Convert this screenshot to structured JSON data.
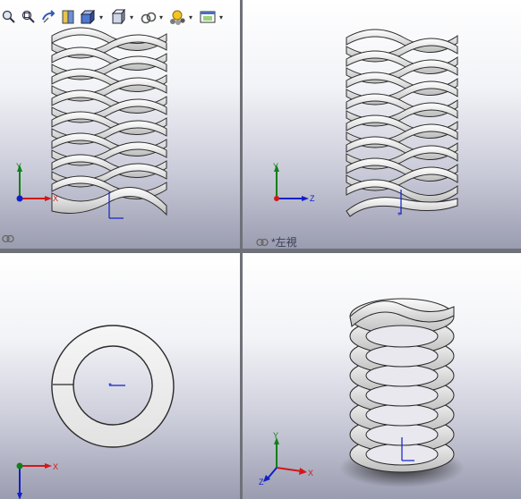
{
  "toolbar": {
    "buttons": [
      {
        "name": "zoom-to-fit-icon"
      },
      {
        "name": "zoom-to-area-icon"
      },
      {
        "name": "previous-view-icon"
      },
      {
        "name": "section-view-icon"
      },
      {
        "name": "view-orientation-icon"
      },
      {
        "name": "display-style-icon"
      },
      {
        "name": "hide-show-items-icon"
      },
      {
        "name": "edit-appearance-icon"
      },
      {
        "name": "apply-scene-icon"
      }
    ],
    "dropdown_glyph": "▾"
  },
  "viewports": {
    "front": {
      "label": ""
    },
    "left": {
      "label": "*左視"
    },
    "top": {
      "label": ""
    },
    "iso": {
      "label": ""
    }
  },
  "triad": {
    "x": "X",
    "y": "Y",
    "z": "Z"
  },
  "window": {
    "minimize_glyph": "–"
  },
  "colors": {
    "axis_x": "#d01818",
    "axis_y": "#128018",
    "axis_z": "#1020c8",
    "part_face": "#f4f4f4",
    "part_edge": "#2a2a2a"
  }
}
